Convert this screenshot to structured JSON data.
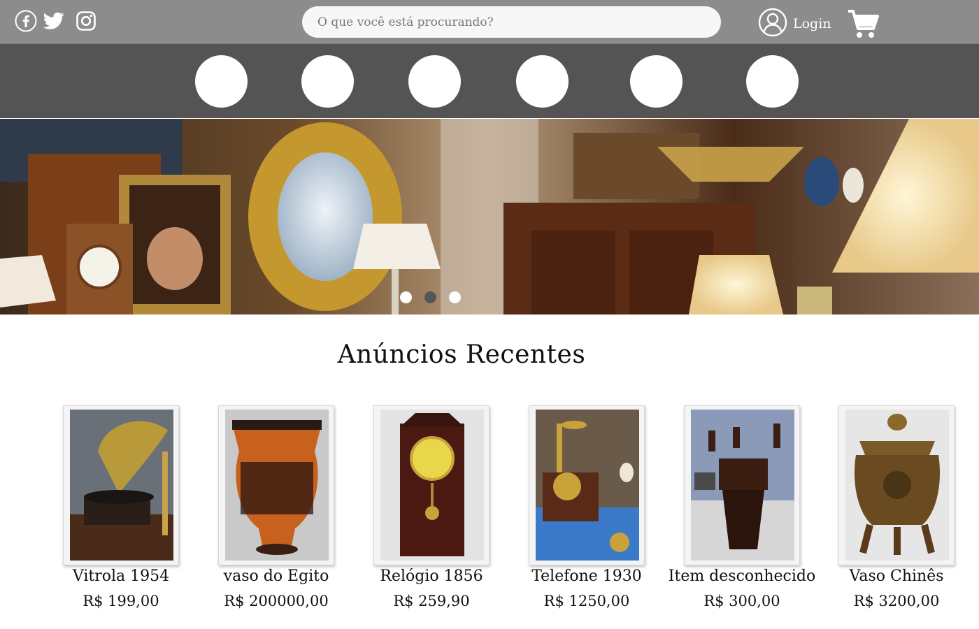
{
  "header": {
    "social": [
      {
        "icon": "facebook-icon"
      },
      {
        "icon": "twitter-icon"
      },
      {
        "icon": "instagram-icon"
      }
    ],
    "search_placeholder": "O que você está procurando?",
    "login_label": "Login",
    "login_icon": "user-circle-icon",
    "cart_icon": "shopping-cart-icon"
  },
  "categories": [
    {
      "icon": "category-circle-1"
    },
    {
      "icon": "category-circle-2"
    },
    {
      "icon": "category-circle-3"
    },
    {
      "icon": "category-circle-4"
    },
    {
      "icon": "category-circle-5"
    },
    {
      "icon": "category-circle-6"
    }
  ],
  "banner": {
    "slides": 3,
    "active_slide": 2
  },
  "section": {
    "title": "Anúncios Recentes"
  },
  "products": [
    {
      "name": "Vitrola 1954",
      "price": "R$ 199,00"
    },
    {
      "name": "vaso do Egito",
      "price": "R$ 200000,00"
    },
    {
      "name": "Relógio 1856",
      "price": "R$ 259,90"
    },
    {
      "name": "Telefone 1930",
      "price": "R$ 1250,00"
    },
    {
      "name": "Item desconhecido",
      "price": "R$ 300,00"
    },
    {
      "name": "Vaso Chinês",
      "price": "R$ 3200,00"
    }
  ],
  "colors": {
    "topbar": "#8c8c8c",
    "catbar": "#545454",
    "search_bg": "#f7f7f7"
  }
}
